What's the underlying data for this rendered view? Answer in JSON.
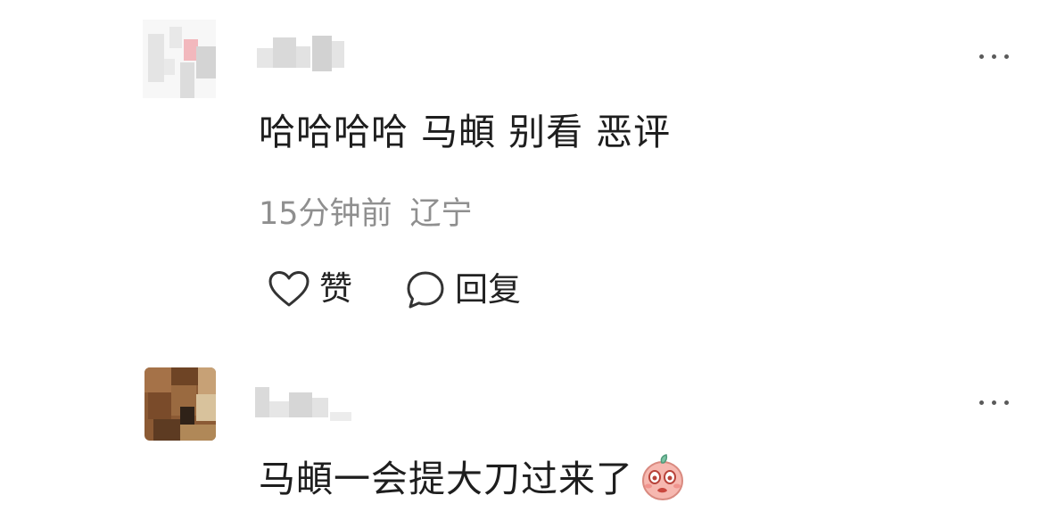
{
  "comments": [
    {
      "text": "哈哈哈哈 马頔 别看 恶评",
      "time": "15分钟前",
      "location": "辽宁",
      "like_label": "赞",
      "reply_label": "回复",
      "avatar_icon": "blurred-avatar",
      "more_icon": "more-dots-icon"
    },
    {
      "text": "马頔一会提大刀过来了",
      "emoji_icon": "face-emoji-icon",
      "avatar_icon": "blurred-avatar",
      "more_icon": "more-dots-icon"
    }
  ],
  "colors": {
    "text_primary": "#1e1e1e",
    "text_secondary": "#8f8f8f",
    "emoji_fill": "#f6b8b0",
    "emoji_leaf": "#7cc4a4"
  }
}
